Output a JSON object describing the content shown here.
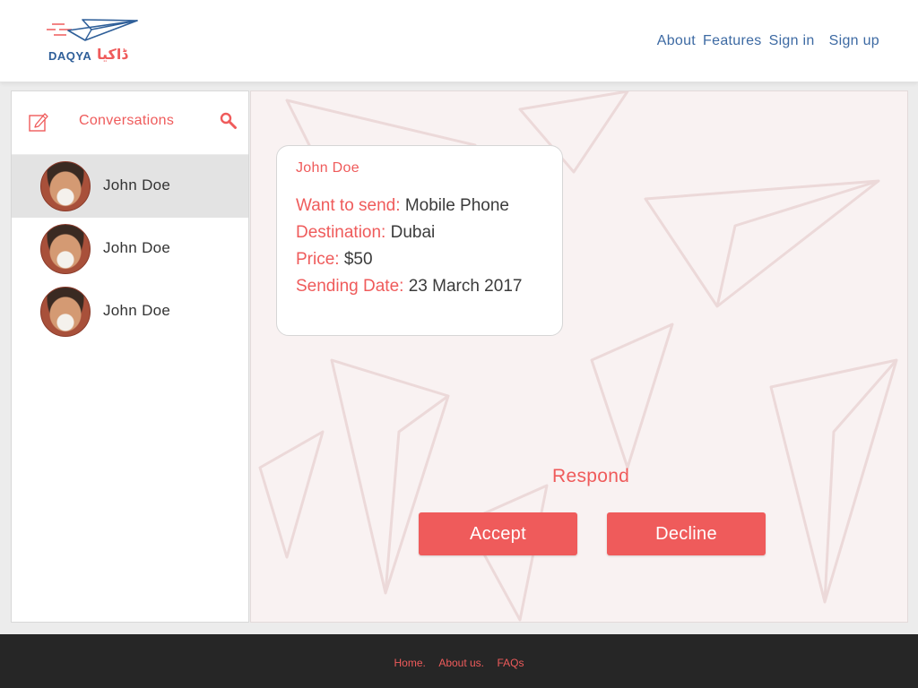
{
  "brand": {
    "name": "DAQYA",
    "arabic": "ڈاکیا",
    "logo_icon": "paper-plane-icon"
  },
  "nav": {
    "about": "About",
    "features": "Features",
    "sign_in": "Sign in",
    "sign_up": "Sign up"
  },
  "sidebar": {
    "title": "Conversations",
    "compose_icon": "compose-icon",
    "search_icon": "search-icon",
    "conversations": [
      {
        "name": "John Doe",
        "active": true
      },
      {
        "name": "John Doe",
        "active": false
      },
      {
        "name": "John Doe",
        "active": false
      }
    ]
  },
  "request": {
    "sender": "John Doe",
    "fields": [
      {
        "label": "Want to send:",
        "value": "Mobile Phone"
      },
      {
        "label": "Destination:",
        "value": "Dubai"
      },
      {
        "label": "Price:",
        "value": "$50"
      },
      {
        "label": "Sending Date:",
        "value": "23 March 2017"
      }
    ]
  },
  "respond": {
    "title": "Respond",
    "accept": "Accept",
    "decline": "Decline"
  },
  "footer": {
    "home": "Home.",
    "about_us": "About us.",
    "faqs": "FAQs"
  },
  "colors": {
    "accent": "#ef5b5b",
    "brand_blue": "#2f5f99",
    "footer_bg": "#262626",
    "panel_bg": "#f9f2f2"
  }
}
